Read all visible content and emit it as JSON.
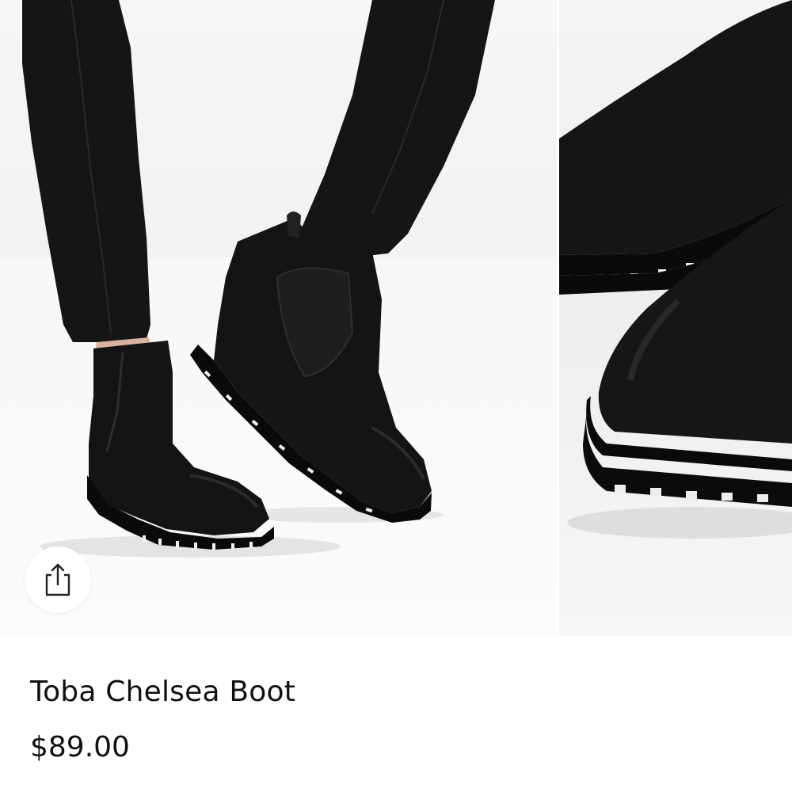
{
  "product": {
    "name": "Toba Chelsea Boot",
    "price": "$89.00"
  },
  "share": {
    "icon": "share-icon"
  },
  "colors": {
    "text": "#111111",
    "background": "#ffffff",
    "boot": "#141414",
    "pants": "#151515"
  }
}
